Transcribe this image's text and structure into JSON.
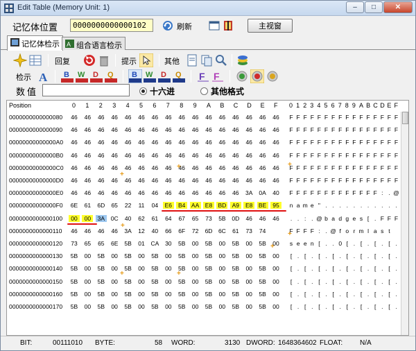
{
  "window": {
    "title": "Edit Table (Memory Unit: 1)",
    "minimize": "–",
    "maximize": "□",
    "close": "✕"
  },
  "top": {
    "mempos_label": "记忆体位置",
    "mempos_value": "0000000000000102",
    "refresh_label": "刷新",
    "main_window_label": "主视窗"
  },
  "tabs": [
    {
      "label": "记忆体检示"
    },
    {
      "label": "组合语言检示"
    }
  ],
  "toolbar1": {
    "restore_label": "回复",
    "hint_label": "提示",
    "other_label": "其他"
  },
  "toolbar2": {
    "inspect_label": "检示"
  },
  "value_row": {
    "label": "数值",
    "radio_hex": "十六进",
    "radio_other": "其他格式"
  },
  "grid": {
    "columns": [
      "Position",
      "0",
      "1",
      "2",
      "3",
      "4",
      "5",
      "6",
      "7",
      "8",
      "9",
      "A",
      "B",
      "C",
      "D",
      "E",
      "F",
      "0",
      "1",
      "2",
      "3",
      "4",
      "5",
      "6",
      "7",
      "8",
      "9",
      "A",
      "B",
      "C",
      "D",
      "E",
      "F"
    ],
    "rows": [
      {
        "addr": "0000000000000080",
        "hex": [
          "46",
          "46",
          "46",
          "46",
          "46",
          "46",
          "46",
          "46",
          "46",
          "46",
          "46",
          "46",
          "46",
          "46",
          "46",
          "46"
        ],
        "ascii": [
          "F",
          "F",
          "F",
          "F",
          "F",
          "F",
          "F",
          "F",
          "F",
          "F",
          "F",
          "F",
          "F",
          "F",
          "F",
          "F"
        ]
      },
      {
        "addr": "0000000000000090",
        "hex": [
          "46",
          "46",
          "46",
          "46",
          "46",
          "46",
          "46",
          "46",
          "46",
          "46",
          "46",
          "46",
          "46",
          "46",
          "46",
          "46"
        ],
        "ascii": [
          "F",
          "F",
          "F",
          "F",
          "F",
          "F",
          "F",
          "F",
          "F",
          "F",
          "F",
          "F",
          "F",
          "F",
          "F",
          "F"
        ]
      },
      {
        "addr": "00000000000000A0",
        "hex": [
          "46",
          "46",
          "46",
          "46",
          "46",
          "46",
          "46",
          "46",
          "46",
          "46",
          "46",
          "46",
          "46",
          "46",
          "46",
          "46"
        ],
        "ascii": [
          "F",
          "F",
          "F",
          "F",
          "F",
          "F",
          "F",
          "F",
          "F",
          "F",
          "F",
          "F",
          "F",
          "F",
          "F",
          "F"
        ]
      },
      {
        "addr": "00000000000000B0",
        "hex": [
          "46",
          "46",
          "46",
          "46",
          "46",
          "46",
          "46",
          "46",
          "46",
          "46",
          "46",
          "46",
          "46",
          "46",
          "46",
          "46"
        ],
        "ascii": [
          "F",
          "F",
          "F",
          "F",
          "F",
          "F",
          "F",
          "F",
          "F",
          "F",
          "F",
          "F",
          "F",
          "F",
          "F",
          "F"
        ]
      },
      {
        "addr": "00000000000000C0",
        "hex": [
          "46",
          "46",
          "46",
          "46",
          "46",
          "46",
          "46",
          "46",
          "46",
          "46",
          "46",
          "46",
          "46",
          "46",
          "46",
          "46"
        ],
        "ascii": [
          "F",
          "F",
          "F",
          "F",
          "F",
          "F",
          "F",
          "F",
          "F",
          "F",
          "F",
          "F",
          "F",
          "F",
          "F",
          "F"
        ]
      },
      {
        "addr": "00000000000000D0",
        "hex": [
          "46",
          "46",
          "46",
          "46",
          "46",
          "46",
          "46",
          "46",
          "46",
          "46",
          "46",
          "46",
          "46",
          "46",
          "46",
          "46"
        ],
        "ascii": [
          "F",
          "F",
          "F",
          "F",
          "F",
          "F",
          "F",
          "F",
          "F",
          "F",
          "F",
          "F",
          "F",
          "F",
          "F",
          "F"
        ]
      },
      {
        "addr": "00000000000000E0",
        "hex": [
          "46",
          "46",
          "46",
          "46",
          "46",
          "46",
          "46",
          "46",
          "46",
          "46",
          "46",
          "46",
          "46",
          "3A",
          "0A",
          "40"
        ],
        "ascii": [
          "F",
          "F",
          "F",
          "F",
          "F",
          "F",
          "F",
          "F",
          "F",
          "F",
          "F",
          "F",
          "F",
          ":",
          ".",
          "@"
        ]
      },
      {
        "addr": "00000000000000F0",
        "hex": [
          "6E",
          "61",
          "6D",
          "65",
          "22",
          "11",
          "04",
          "E6",
          "B4",
          "AA",
          "E8",
          "BD",
          "A9",
          "E8",
          "BE",
          "95"
        ],
        "ascii": [
          "n",
          "a",
          "m",
          "e",
          "\"",
          ".",
          ".",
          ".",
          ".",
          ".",
          ".",
          ".",
          ".",
          ".",
          ".",
          "."
        ]
      },
      {
        "addr": "0000000000000100",
        "hex": [
          "00",
          "00",
          "3A",
          "0C",
          "40",
          "62",
          "61",
          "64",
          "67",
          "65",
          "73",
          "5B",
          "0D",
          "46",
          "46",
          "46"
        ],
        "ascii": [
          ".",
          ".",
          ":",
          ".",
          "@",
          "b",
          "a",
          "d",
          "g",
          "e",
          "s",
          "[",
          ".",
          "F",
          "F",
          "F"
        ]
      },
      {
        "addr": "0000000000000110",
        "hex": [
          "46",
          "46",
          "46",
          "46",
          "3A",
          "12",
          "40",
          "66",
          "6F",
          "72",
          "6D",
          "6C",
          "61",
          "73",
          "74"
        ],
        "ascii": [
          "F",
          "F",
          "F",
          "F",
          ":",
          ".",
          "@",
          "f",
          "o",
          "r",
          "m",
          "l",
          "a",
          "s",
          "t"
        ]
      },
      {
        "addr": "0000000000000120",
        "hex": [
          "73",
          "65",
          "65",
          "6E",
          "5B",
          "01",
          "CA",
          "30",
          "5B",
          "00",
          "5B",
          "00",
          "5B",
          "00",
          "5B",
          "00"
        ],
        "ascii": [
          "s",
          "e",
          "e",
          "n",
          "[",
          ".",
          ".",
          "0",
          "[",
          ".",
          "[",
          ".",
          "[",
          ".",
          "[",
          "."
        ]
      },
      {
        "addr": "0000000000000130",
        "hex": [
          "5B",
          "00",
          "5B",
          "00",
          "5B",
          "00",
          "5B",
          "00",
          "5B",
          "00",
          "5B",
          "00",
          "5B",
          "00",
          "5B",
          "00"
        ],
        "ascii": [
          "[",
          ".",
          "[",
          ".",
          "[",
          ".",
          "[",
          ".",
          "[",
          ".",
          "[",
          ".",
          "[",
          ".",
          "[",
          "."
        ]
      },
      {
        "addr": "0000000000000140",
        "hex": [
          "5B",
          "00",
          "5B",
          "00",
          "5B",
          "00",
          "5B",
          "00",
          "5B",
          "00",
          "5B",
          "00",
          "5B",
          "00",
          "5B",
          "00"
        ],
        "ascii": [
          "[",
          ".",
          "[",
          ".",
          "[",
          ".",
          "[",
          ".",
          "[",
          ".",
          "[",
          ".",
          "[",
          ".",
          "[",
          "."
        ]
      },
      {
        "addr": "0000000000000150",
        "hex": [
          "5B",
          "00",
          "5B",
          "00",
          "5B",
          "00",
          "5B",
          "00",
          "5B",
          "00",
          "5B",
          "00",
          "5B",
          "00",
          "5B",
          "00"
        ],
        "ascii": [
          "[",
          ".",
          "[",
          ".",
          "[",
          ".",
          "[",
          ".",
          "[",
          ".",
          "[",
          ".",
          "[",
          ".",
          "[",
          "."
        ]
      },
      {
        "addr": "0000000000000160",
        "hex": [
          "5B",
          "00",
          "5B",
          "00",
          "5B",
          "00",
          "5B",
          "00",
          "5B",
          "00",
          "5B",
          "00",
          "5B",
          "00",
          "5B",
          "00"
        ],
        "ascii": [
          "[",
          ".",
          "[",
          ".",
          "[",
          ".",
          "[",
          ".",
          "[",
          ".",
          "[",
          ".",
          "[",
          ".",
          "[",
          "."
        ]
      },
      {
        "addr": "0000000000000170",
        "hex": [
          "5B",
          "00",
          "5B",
          "00",
          "5B",
          "00",
          "5B",
          "00",
          "5B",
          "00",
          "5B",
          "00",
          "5B",
          "00",
          "5B",
          "00"
        ],
        "ascii": [
          "[",
          ".",
          "[",
          ".",
          "[",
          ".",
          "[",
          ".",
          "[",
          ".",
          "[",
          ".",
          "[",
          ".",
          "[",
          "."
        ]
      }
    ]
  },
  "status": {
    "bit_label": "BIT:",
    "bit_value": "00111010",
    "byte_label": "BYTE:",
    "byte_value": "58",
    "word_label": "WORD:",
    "word_value": "3130",
    "dword_label": "DWORD:",
    "dword_value": "1648364602",
    "float_label": "FLOAT:",
    "float_value": "N/A"
  },
  "colors": {
    "highlight_yellow": "#ffff2a",
    "highlight_blue": "#9dc8f0",
    "annotation_red": "#e01010",
    "input_yellow": "#fffec6"
  }
}
